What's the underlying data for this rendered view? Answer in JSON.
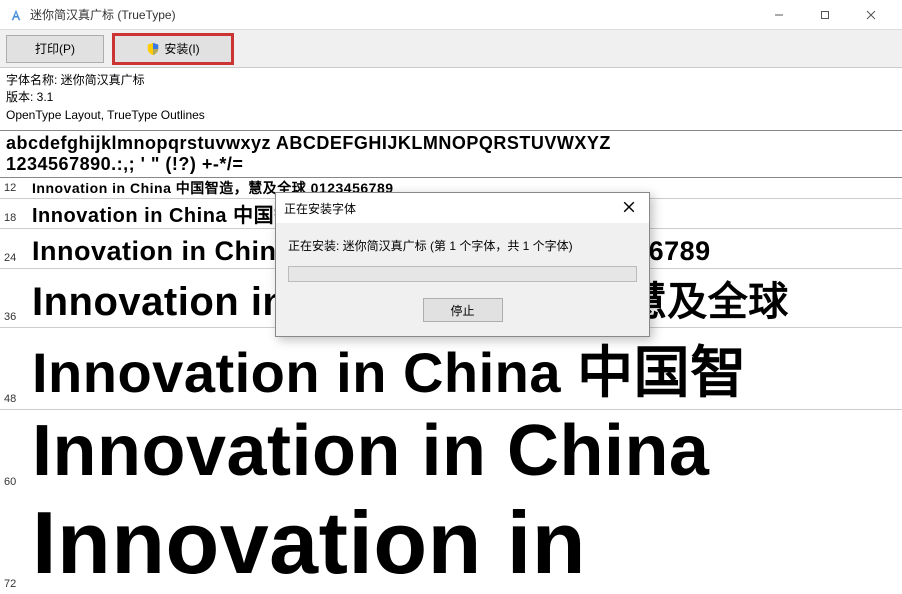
{
  "titlebar": {
    "title": "迷你简汉真广标 (TrueType)"
  },
  "toolbar": {
    "print_label": "打印(P)",
    "install_label": "安装(I)"
  },
  "info": {
    "name_line": "字体名称: 迷你简汉真广标",
    "version_line": "版本: 3.1",
    "outline_line": "OpenType Layout, TrueType Outlines"
  },
  "glyphs": {
    "row1": "abcdefghijklmnopqrstuvwxyz  ABCDEFGHIJKLMNOPQRSTUVWXYZ",
    "row2": "1234567890.:,; ' \" (!?) +-*/="
  },
  "samples": [
    {
      "size": "12",
      "text": "Innovation in China 中国智造，慧及全球 0123456789",
      "px": 14
    },
    {
      "size": "18",
      "text": "Innovation in China 中国智造，慧及全球 0123456789",
      "px": 20
    },
    {
      "size": "24",
      "text": "Innovation in China 中国智造，慧及全球 0123456789",
      "px": 27
    },
    {
      "size": "36",
      "text": "Innovation in China 中国智造，慧及全球",
      "px": 40
    },
    {
      "size": "48",
      "text": "Innovation in China 中国智",
      "px": 56
    },
    {
      "size": "60",
      "text": "Innovation in China",
      "px": 72
    },
    {
      "size": "72",
      "text": "Innovation in",
      "px": 88
    }
  ],
  "dialog": {
    "title": "正在安装字体",
    "message": "正在安装: 迷你简汉真广标 (第 1 个字体，共 1 个字体)",
    "stop_label": "停止"
  }
}
